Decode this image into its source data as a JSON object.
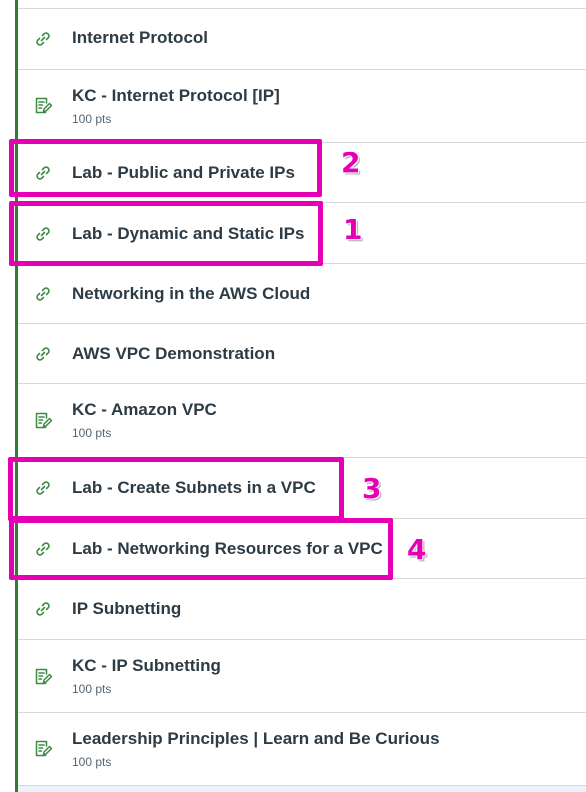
{
  "items": [
    {
      "title": "Internet Protocol",
      "type": "link"
    },
    {
      "title": "KC - Internet Protocol [IP]",
      "type": "quiz",
      "points": "100 pts"
    },
    {
      "title": "Lab - Public and Private IPs",
      "type": "link"
    },
    {
      "title": "Lab - Dynamic and Static IPs",
      "type": "link"
    },
    {
      "title": "Networking in the AWS Cloud",
      "type": "link"
    },
    {
      "title": "AWS VPC Demonstration",
      "type": "link"
    },
    {
      "title": "KC - Amazon VPC",
      "type": "quiz",
      "points": "100 pts"
    },
    {
      "title": "Lab - Create Subnets in a VPC",
      "type": "link"
    },
    {
      "title": "Lab - Networking Resources for a VPC",
      "type": "link"
    },
    {
      "title": "IP Subnetting",
      "type": "link"
    },
    {
      "title": "KC - IP Subnetting",
      "type": "quiz",
      "points": "100 pts"
    },
    {
      "title": "Leadership Principles | Learn and Be Curious",
      "type": "quiz",
      "points": "100 pts"
    }
  ],
  "annotations": [
    {
      "label": "2",
      "target": "Lab - Public and Private IPs"
    },
    {
      "label": "1",
      "target": "Lab - Dynamic and Static IPs"
    },
    {
      "label": "3",
      "target": "Lab - Create Subnets in a VPC"
    },
    {
      "label": "4",
      "target": "Lab - Networking Resources for a VPC"
    }
  ],
  "colors": {
    "highlight": "#e500b4",
    "rail": "#2e7d32",
    "icon": "#3b8b45",
    "text": "#2d3b45",
    "divider": "#d5d8dc"
  },
  "icons": {
    "link": "link-icon",
    "quiz": "quiz-icon"
  }
}
